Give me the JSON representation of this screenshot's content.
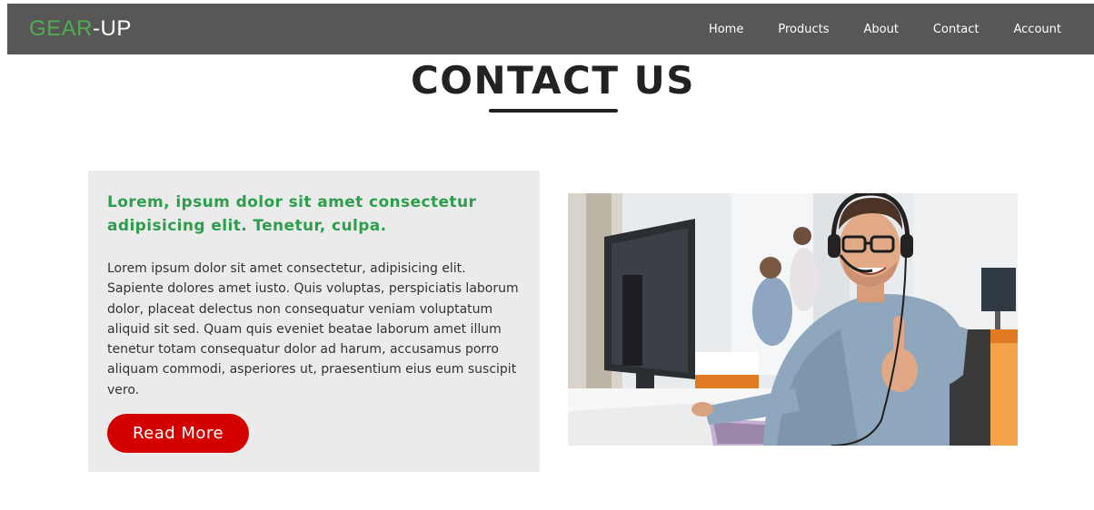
{
  "nav": {
    "logo_prefix": "GEAR",
    "logo_suffix": "-UP",
    "links": [
      "Home",
      "Products",
      "About",
      "Contact",
      "Account"
    ]
  },
  "page": {
    "heading": "CONTACT US"
  },
  "card": {
    "title": "Lorem, ipsum dolor sit amet consectetur adipisicing elit. Tenetur, culpa.",
    "body": "Lorem ipsum dolor sit amet consectetur, adipisicing elit. Sapiente dolores amet iusto. Quis voluptas, perspiciatis laborum dolor, placeat delectus non consequatur veniam voluptatum aliquid sit sed. Quam quis eveniet beatae laborum amet illum tenetur totam consequatur dolor ad harum, accusamus porro aliquam commodi, asperiores ut, praesentium eius eum suscipit vero.",
    "button_label": "Read More"
  },
  "colors": {
    "navbar": "#575757",
    "logo_accent": "#4caf50",
    "title_green": "#2e9e4c",
    "button_red": "#d40000",
    "card_bg": "#ebebeb"
  },
  "image": {
    "subject": "customer support agent with headset giving thumbs up in office"
  }
}
